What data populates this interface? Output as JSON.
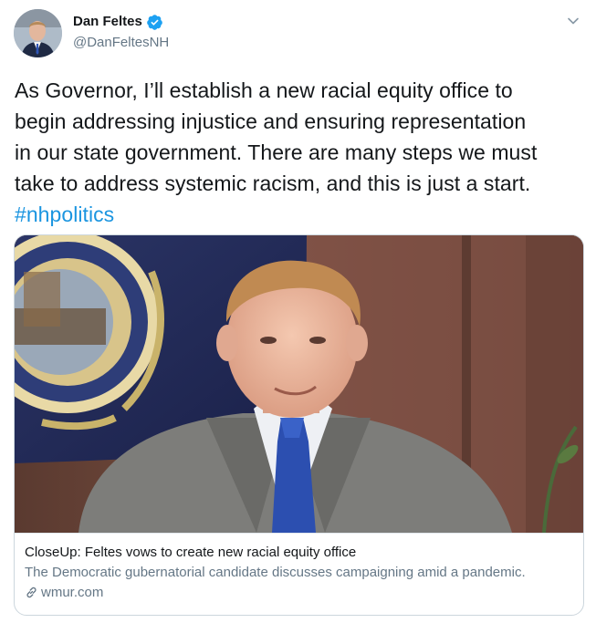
{
  "author": {
    "name": "Dan Feltes",
    "handle": "@DanFeltesNH",
    "verified": true
  },
  "tweet": {
    "text": "As Governor, I’ll establish a new racial equity office to\nbegin addressing injustice and ensuring representation\nin our state government. There are many steps we must\ntake to address systemic racism, and this is just a start.",
    "hashtag": "#nhpolitics"
  },
  "card": {
    "title": "CloseUp: Feltes vows to create new racial equity office",
    "description": "The Democratic gubernatorial candidate discusses campaigning amid a pandemic.",
    "domain": "wmur.com"
  },
  "colors": {
    "link": "#1b95e0",
    "verified": "#1da1f2",
    "secondary_text": "#657786",
    "border": "#ccd6dd"
  },
  "icons": {
    "verified": "verified-badge-icon",
    "caret": "chevron-down-icon",
    "link": "link-icon"
  }
}
